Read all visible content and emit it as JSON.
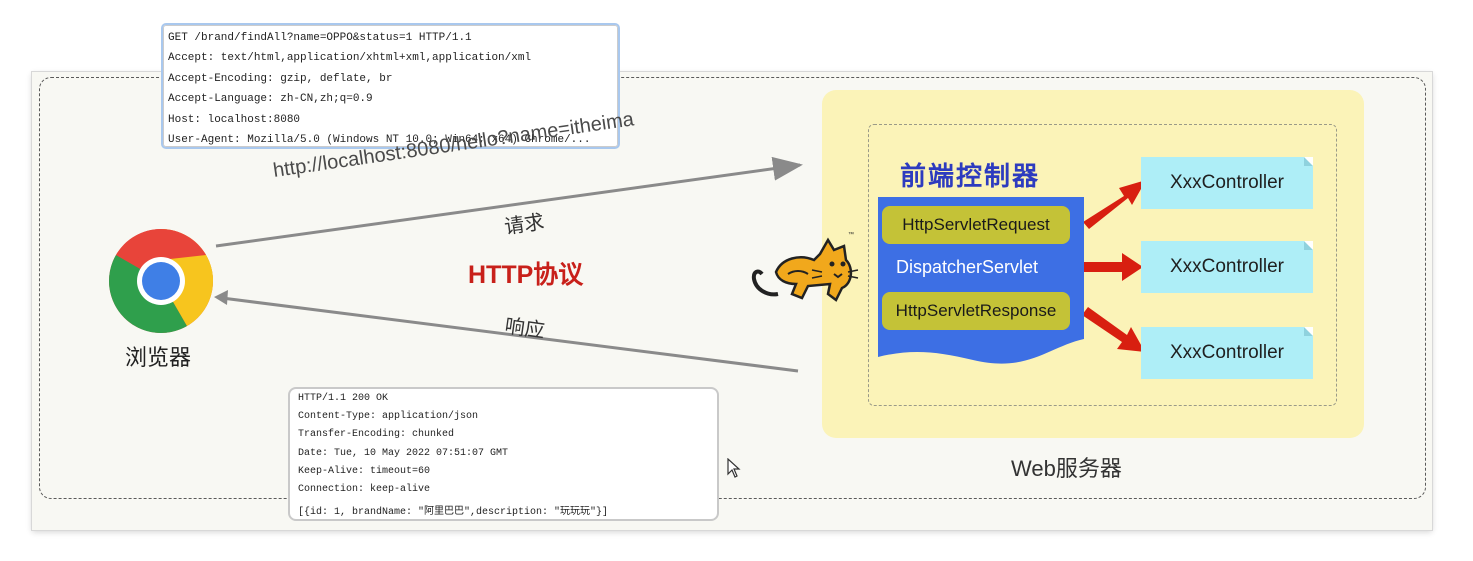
{
  "request_box": {
    "lines": [
      "GET /brand/findAll?name=OPPO&status=1 HTTP/1.1",
      "Accept: text/html,application/xhtml+xml,application/xml",
      "Accept-Encoding: gzip, deflate, br",
      "Accept-Language: zh-CN,zh;q=0.9",
      "Host: localhost:8080",
      "User-Agent: Mozilla/5.0 (Windows NT 10.0; Win64; x64) Chrome/..."
    ]
  },
  "response_box": {
    "lines": [
      "HTTP/1.1 200 OK",
      "Content-Type: application/json",
      "Transfer-Encoding: chunked",
      "Date: Tue, 10 May 2022 07:51:07 GMT",
      "Keep-Alive: timeout=60",
      "Connection: keep-alive"
    ],
    "body": "[{id: 1, brandName: \"阿里巴巴\",description: \"玩玩玩\"}]"
  },
  "browser": {
    "label": "浏览器",
    "icon": "chrome-icon"
  },
  "protocol": {
    "title": "HTTP协议",
    "color": "#c8201a"
  },
  "request": {
    "url": "http://localhost:8080/hello?name=itheima",
    "label": "请求"
  },
  "response": {
    "label": "响应"
  },
  "server": {
    "label": "Web服务器",
    "icon": "tomcat-icon",
    "front_controller": {
      "title": "前端控制器",
      "request_object": "HttpServletRequest",
      "dispatcher": "DispatcherServlet",
      "response_object": "HttpServletResponse"
    },
    "controllers": [
      "XxxController",
      "XxxController",
      "XxxController"
    ]
  },
  "colors": {
    "server_bg": "#fbf3b8",
    "dispatcher_blue": "#3d6fe4",
    "controller_bg": "#aeeef7",
    "arrow_red": "#d81f10",
    "pill_olive": "#c4c237"
  }
}
